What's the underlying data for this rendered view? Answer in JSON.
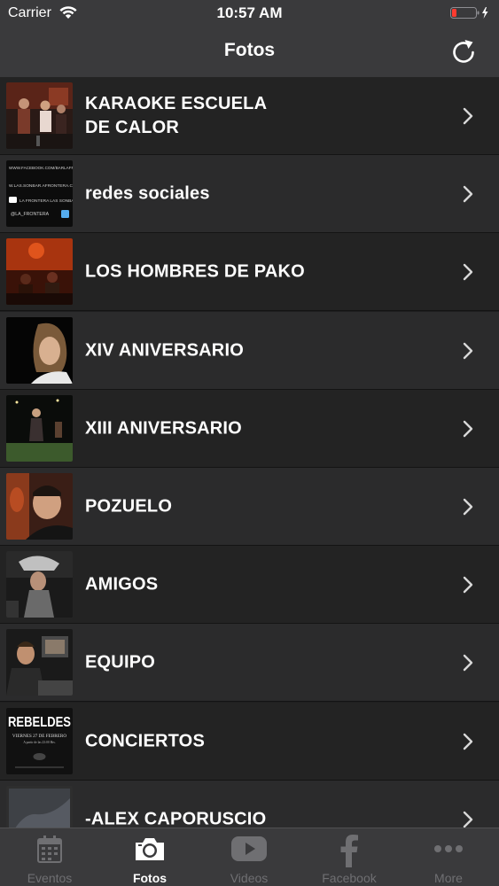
{
  "status_bar": {
    "carrier": "Carrier",
    "time": "10:57 AM"
  },
  "nav": {
    "title": "Fotos",
    "refresh_icon": "refresh-icon"
  },
  "albums": [
    {
      "title": "KARAOKE ESCUELA\nDE CALOR",
      "thumb": "karaoke"
    },
    {
      "title": "redes sociales",
      "thumb": "redes",
      "thumb_text": [
        "WWW.FACEBOOK.COM/BARLAFRONTERA",
        "W.LAS.SONBAR.AFRONTERA.COM",
        "LA FRONTERA LAS SONBAR",
        "@LA_FRONTERA"
      ]
    },
    {
      "title": "LOS HOMBRES DE PAKO",
      "thumb": "band"
    },
    {
      "title": "XIV ANIVERSARIO",
      "thumb": "woman"
    },
    {
      "title": "XIII ANIVERSARIO",
      "thumb": "night"
    },
    {
      "title": "POZUELO",
      "thumb": "man"
    },
    {
      "title": "AMIGOS",
      "thumb": "friends"
    },
    {
      "title": "EQUIPO",
      "thumb": "team"
    },
    {
      "title": "CONCIERTOS",
      "thumb": "poster",
      "thumb_text": [
        "REBELDES",
        "VIERNES 27 DE FEBRERO",
        "A partir de las 23:00 Hrs."
      ]
    },
    {
      "title": "-ALEX CAPORUSCIO",
      "thumb": "gray"
    }
  ],
  "tabs": [
    {
      "label": "Eventos",
      "icon": "calendar-icon",
      "active": false
    },
    {
      "label": "Fotos",
      "icon": "camera-icon",
      "active": true
    },
    {
      "label": "Videos",
      "icon": "youtube-icon",
      "active": false
    },
    {
      "label": "Facebook",
      "icon": "facebook-icon",
      "active": false
    },
    {
      "label": "More",
      "icon": "more-icon",
      "active": false
    }
  ],
  "colors": {
    "bar": "#3a3a3c",
    "row_odd": "#232323",
    "row_even": "#2b2b2c",
    "tab_inactive": "#6f6f72",
    "battery": "#ff3b30"
  }
}
